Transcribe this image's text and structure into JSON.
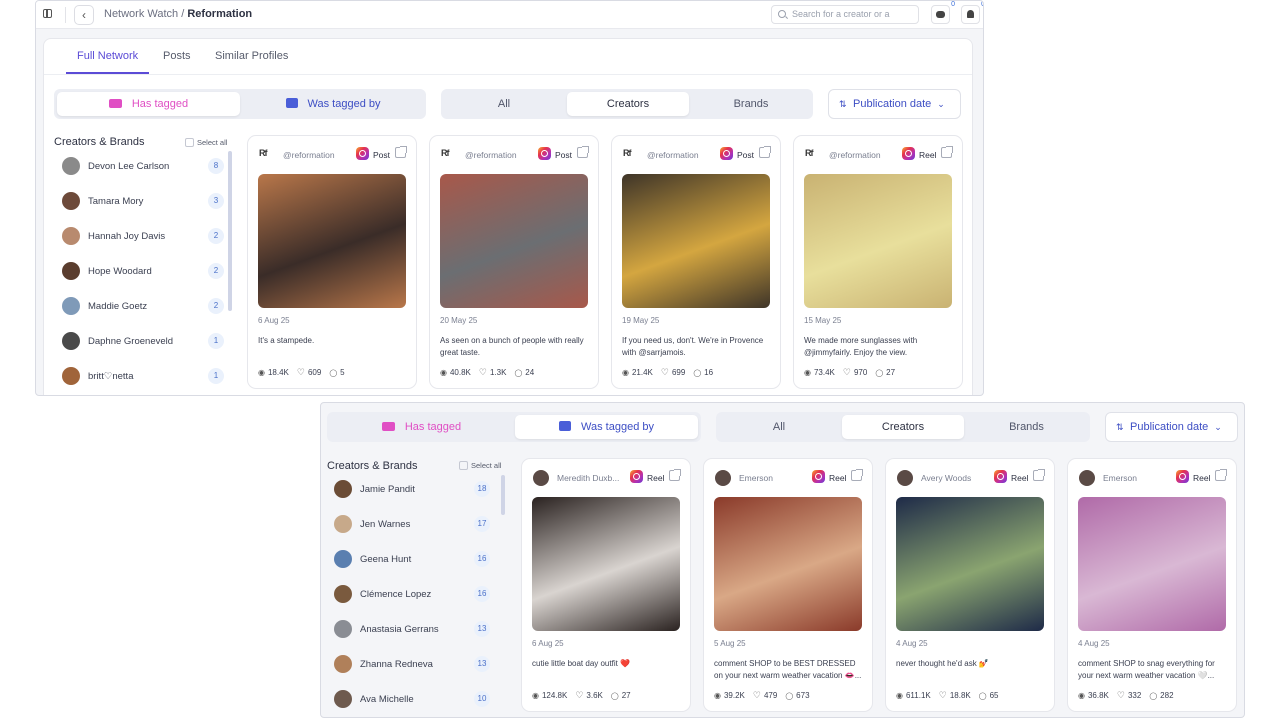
{
  "topbar": {
    "crumb_root": "Network Watch",
    "crumb_sep": "/",
    "crumb_current": "Reformation",
    "search_placeholder": "Search for a creator or a",
    "chat_badge": "0",
    "bell_badge": "0"
  },
  "tabs": [
    {
      "label": "Full Network"
    },
    {
      "label": "Posts"
    },
    {
      "label": "Similar Profiles"
    }
  ],
  "filters": {
    "has_tagged": "Has tagged",
    "was_tagged_by": "Was tagged by",
    "all": "All",
    "creators": "Creators",
    "brands": "Brands",
    "sort": "Publication date"
  },
  "list": {
    "heading": "Creators & Brands",
    "select_all": "Select all"
  },
  "view_a": {
    "people": [
      {
        "name": "Devon Lee Carlson",
        "count": "8",
        "color": "#8a8a8a"
      },
      {
        "name": "Tamara Mory",
        "count": "3",
        "color": "#6d4a3a"
      },
      {
        "name": "Hannah Joy Davis",
        "count": "2",
        "color": "#b88a6e"
      },
      {
        "name": "Hope Woodard",
        "count": "2",
        "color": "#5a3d2e"
      },
      {
        "name": "Maddie Goetz",
        "count": "2",
        "color": "#7f9ab8"
      },
      {
        "name": "Daphne Groeneveld",
        "count": "1",
        "color": "#4a4a4a"
      },
      {
        "name": "britt♡netta",
        "count": "1",
        "color": "#a0643a"
      }
    ],
    "posts": [
      {
        "handle": "@reformation",
        "type": "Post",
        "date": "6 Aug 25",
        "caption": "It's a stampede.",
        "views": "18.4K",
        "likes": "609",
        "comments": "5",
        "c1": "#b9774a",
        "c2": "#3a2c28"
      },
      {
        "handle": "@reformation",
        "type": "Post",
        "date": "20 May 25",
        "caption": "As seen on a bunch of people with really great taste.",
        "views": "40.8K",
        "likes": "1.3K",
        "comments": "24",
        "c1": "#a8584a",
        "c2": "#6b6e72"
      },
      {
        "handle": "@reformation",
        "type": "Post",
        "date": "19 May 25",
        "caption": "If you need us, don't. We're in Provence with @sarrjamois.",
        "views": "21.4K",
        "likes": "699",
        "comments": "16",
        "c1": "#3e3428",
        "c2": "#d4a640"
      },
      {
        "handle": "@reformation",
        "type": "Reel",
        "date": "15 May 25",
        "caption": "We made more sunglasses with @jimmyfairly. Enjoy the view.",
        "views": "73.4K",
        "likes": "970",
        "comments": "27",
        "c1": "#c9b272",
        "c2": "#e8df9c"
      }
    ]
  },
  "view_b": {
    "people": [
      {
        "name": "Jamie Pandit",
        "count": "18",
        "color": "#6b4c36"
      },
      {
        "name": "Jen Warnes",
        "count": "17",
        "color": "#c7a98a"
      },
      {
        "name": "Geena Hunt",
        "count": "16",
        "color": "#5a7fb0"
      },
      {
        "name": "Clémence Lopez",
        "count": "16",
        "color": "#7a5a3e"
      },
      {
        "name": "Anastasia Gerrans",
        "count": "13",
        "color": "#8a8d94"
      },
      {
        "name": "Zhanna Redneva",
        "count": "13",
        "color": "#b0805a"
      },
      {
        "name": "Ava Michelle",
        "count": "10",
        "color": "#6e5a4e"
      }
    ],
    "posts": [
      {
        "handle": "Meredith Duxb...",
        "type": "Reel",
        "date": "6 Aug 25",
        "caption": "cutie little boat day outfit ❤️",
        "views": "124.8K",
        "likes": "3.6K",
        "comments": "27",
        "c1": "#2a2220",
        "c2": "#d9d4d0"
      },
      {
        "handle": "Emerson",
        "type": "Reel",
        "date": "5 Aug 25",
        "caption": "comment SHOP to be BEST DRESSED on your next warm weather vacation 👄...",
        "views": "39.2K",
        "likes": "479",
        "comments": "673",
        "c1": "#8a3a2a",
        "c2": "#d9a886"
      },
      {
        "handle": "Avery Woods",
        "type": "Reel",
        "date": "4 Aug 25",
        "caption": "never thought he'd ask 💅",
        "views": "611.1K",
        "likes": "18.8K",
        "comments": "65",
        "c1": "#1e2a48",
        "c2": "#8aa470"
      },
      {
        "handle": "Emerson",
        "type": "Reel",
        "date": "4 Aug 25",
        "caption": "comment SHOP to snag everything for your next warm weather vacation 🤍...",
        "views": "36.8K",
        "likes": "332",
        "comments": "282",
        "c1": "#b06aa8",
        "c2": "#d9b8d4"
      }
    ]
  }
}
